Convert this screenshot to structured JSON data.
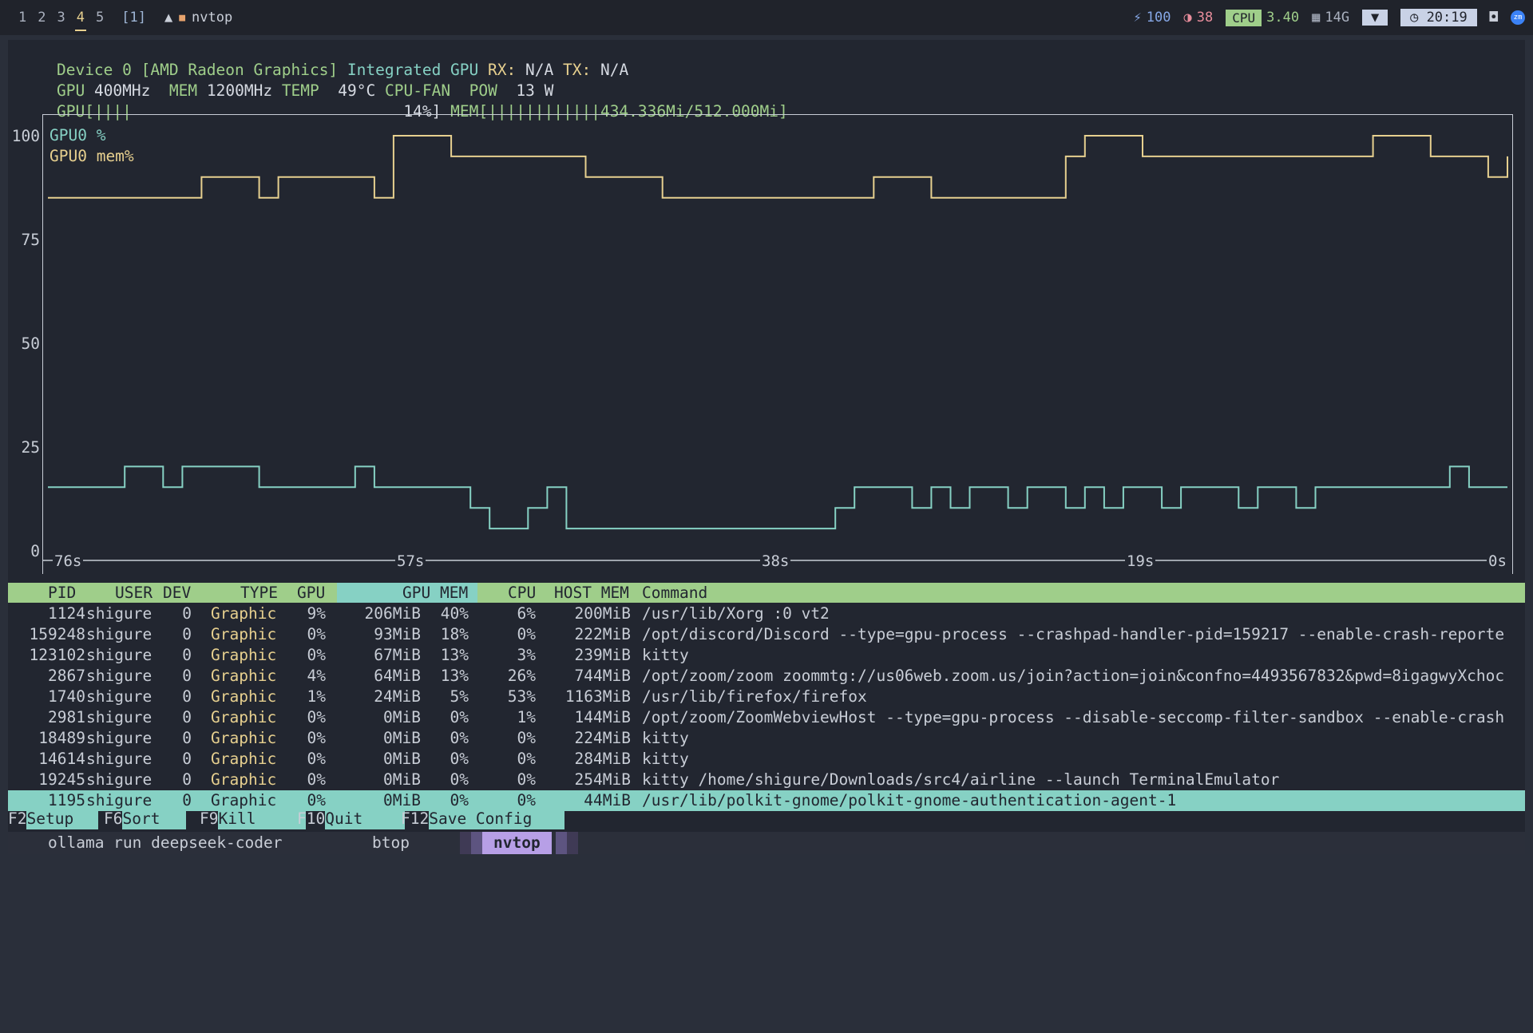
{
  "topbar": {
    "workspaces": [
      "1",
      "2",
      "3",
      "4",
      "5"
    ],
    "active_workspace": "4",
    "window_count": "[1]",
    "app_title": "nvtop",
    "battery": "100",
    "brightness": "38",
    "cpu_label": "CPU",
    "cpu_load": "3.40",
    "mem": "14G",
    "clock": "20:19",
    "zoom_icon_text": "zm"
  },
  "device": {
    "line1_a": "Device 0 [AMD Radeon Graphics]",
    "line1_b": "Integrated GPU",
    "line1_c": "RX:",
    "line1_d": "N/A",
    "line1_e": "TX:",
    "line1_f": "N/A",
    "gpu_clock_label": "GPU",
    "gpu_clock": "400MHz",
    "mem_clock_label": "MEM",
    "mem_clock": "1200MHz",
    "temp_label": "TEMP",
    "temp": "49°C",
    "fan_label": "CPU-FAN",
    "pow_label": "POW",
    "pow": "13 W",
    "gpu_bar_label": "GPU[",
    "gpu_bar": "||||",
    "gpu_pct": "14%]",
    "mem_bar_label": "MEM[",
    "mem_bar": "||||||||||||",
    "mem_val": "434.336Mi/512.000Mi]"
  },
  "chart_data": {
    "type": "line",
    "title": "",
    "ylabel": "",
    "ylim": [
      0,
      100
    ],
    "y_ticks": [
      "100",
      "75",
      "50",
      "25",
      "0"
    ],
    "x_ticks": [
      "76s",
      "57s",
      "38s",
      "19s",
      "0s"
    ],
    "xlim": [
      -76,
      0
    ],
    "series": [
      {
        "name": "GPU0 %",
        "color": "#86d1c4",
        "x": [
          -76,
          -73,
          -72,
          -70,
          -69,
          -65,
          -64,
          -60,
          -59,
          -55,
          -54,
          -53,
          -52,
          -51,
          -50,
          -49,
          -48,
          -45,
          -44,
          -42,
          -41,
          -36,
          -35,
          -34,
          -33,
          -31,
          -30,
          -29,
          -28,
          -26,
          -25,
          -23,
          -22,
          -21,
          -20,
          -18,
          -17,
          -14,
          -13,
          -11,
          -10,
          -4,
          -3,
          -2,
          -1,
          0
        ],
        "values": [
          15,
          15,
          20,
          15,
          20,
          15,
          15,
          20,
          15,
          15,
          10,
          5,
          5,
          10,
          15,
          5,
          5,
          5,
          5,
          5,
          5,
          5,
          10,
          15,
          15,
          10,
          15,
          10,
          15,
          10,
          15,
          10,
          15,
          10,
          15,
          10,
          15,
          10,
          15,
          10,
          15,
          15,
          20,
          15,
          15,
          15
        ]
      },
      {
        "name": "GPU0 mem%",
        "color": "#e7d08f",
        "x": [
          -76,
          -69,
          -68,
          -65,
          -64,
          -59,
          -58,
          -56,
          -55,
          -49,
          -48,
          -45,
          -44,
          -42,
          -41,
          -36,
          -35,
          -34,
          -33,
          -31,
          -30,
          -23,
          -22,
          -20,
          -19,
          -8,
          -7,
          -5,
          -4,
          -1,
          0
        ],
        "values": [
          85,
          85,
          90,
          85,
          90,
          85,
          100,
          100,
          95,
          95,
          90,
          90,
          85,
          85,
          85,
          85,
          85,
          85,
          90,
          90,
          85,
          95,
          100,
          100,
          95,
          95,
          100,
          100,
          95,
          90,
          95
        ]
      }
    ]
  },
  "table": {
    "headers": {
      "pid": "PID",
      "user": "USER",
      "dev": "DEV",
      "type": "TYPE",
      "gpu": "GPU",
      "gpumem": "GPU MEM",
      "cpu": "CPU",
      "hostmem": "HOST MEM",
      "cmd": "Command"
    },
    "rows": [
      {
        "pid": "1124",
        "user": "shigure",
        "dev": "0",
        "type": "Graphic",
        "gpu": "9%",
        "gpumem": "206MiB",
        "gpumempct": "40%",
        "cpu": "6%",
        "hostmem": "200MiB",
        "cmd": "/usr/lib/Xorg :0 vt2"
      },
      {
        "pid": "159248",
        "user": "shigure",
        "dev": "0",
        "type": "Graphic",
        "gpu": "0%",
        "gpumem": "93MiB",
        "gpumempct": "18%",
        "cpu": "0%",
        "hostmem": "222MiB",
        "cmd": "/opt/discord/Discord --type=gpu-process --crashpad-handler-pid=159217 --enable-crash-reporte"
      },
      {
        "pid": "123102",
        "user": "shigure",
        "dev": "0",
        "type": "Graphic",
        "gpu": "0%",
        "gpumem": "67MiB",
        "gpumempct": "13%",
        "cpu": "3%",
        "hostmem": "239MiB",
        "cmd": "kitty"
      },
      {
        "pid": "2867",
        "user": "shigure",
        "dev": "0",
        "type": "Graphic",
        "gpu": "4%",
        "gpumem": "64MiB",
        "gpumempct": "13%",
        "cpu": "26%",
        "hostmem": "744MiB",
        "cmd": "/opt/zoom/zoom zoommtg://us06web.zoom.us/join?action=join&confno=4493567832&pwd=8igagwyXchoc"
      },
      {
        "pid": "1740",
        "user": "shigure",
        "dev": "0",
        "type": "Graphic",
        "gpu": "1%",
        "gpumem": "24MiB",
        "gpumempct": "5%",
        "cpu": "53%",
        "hostmem": "1163MiB",
        "cmd": "/usr/lib/firefox/firefox"
      },
      {
        "pid": "2981",
        "user": "shigure",
        "dev": "0",
        "type": "Graphic",
        "gpu": "0%",
        "gpumem": "0MiB",
        "gpumempct": "0%",
        "cpu": "1%",
        "hostmem": "144MiB",
        "cmd": "/opt/zoom/ZoomWebviewHost --type=gpu-process --disable-seccomp-filter-sandbox --enable-crash"
      },
      {
        "pid": "18489",
        "user": "shigure",
        "dev": "0",
        "type": "Graphic",
        "gpu": "0%",
        "gpumem": "0MiB",
        "gpumempct": "0%",
        "cpu": "0%",
        "hostmem": "224MiB",
        "cmd": "kitty"
      },
      {
        "pid": "14614",
        "user": "shigure",
        "dev": "0",
        "type": "Graphic",
        "gpu": "0%",
        "gpumem": "0MiB",
        "gpumempct": "0%",
        "cpu": "0%",
        "hostmem": "284MiB",
        "cmd": "kitty"
      },
      {
        "pid": "19245",
        "user": "shigure",
        "dev": "0",
        "type": "Graphic",
        "gpu": "0%",
        "gpumem": "0MiB",
        "gpumempct": "0%",
        "cpu": "0%",
        "hostmem": "254MiB",
        "cmd": "kitty /home/shigure/Downloads/src4/airline --launch TerminalEmulator"
      },
      {
        "pid": "1195",
        "user": "shigure",
        "dev": "0",
        "type": "Graphic",
        "gpu": "0%",
        "gpumem": "0MiB",
        "gpumempct": "0%",
        "cpu": "0%",
        "hostmem": "44MiB",
        "cmd": "/usr/lib/polkit-gnome/polkit-gnome-authentication-agent-1"
      }
    ]
  },
  "fkeys": [
    {
      "key": "F2",
      "label": "Setup"
    },
    {
      "key": "F6",
      "label": "Sort"
    },
    {
      "key": "F9",
      "label": "Kill"
    },
    {
      "key": "F10",
      "label": "Quit"
    },
    {
      "key": "F12",
      "label": "Save Config"
    }
  ],
  "tabs": [
    "ollama run deepseek-coder",
    "btop",
    "nvtop"
  ],
  "active_tab": "nvtop"
}
